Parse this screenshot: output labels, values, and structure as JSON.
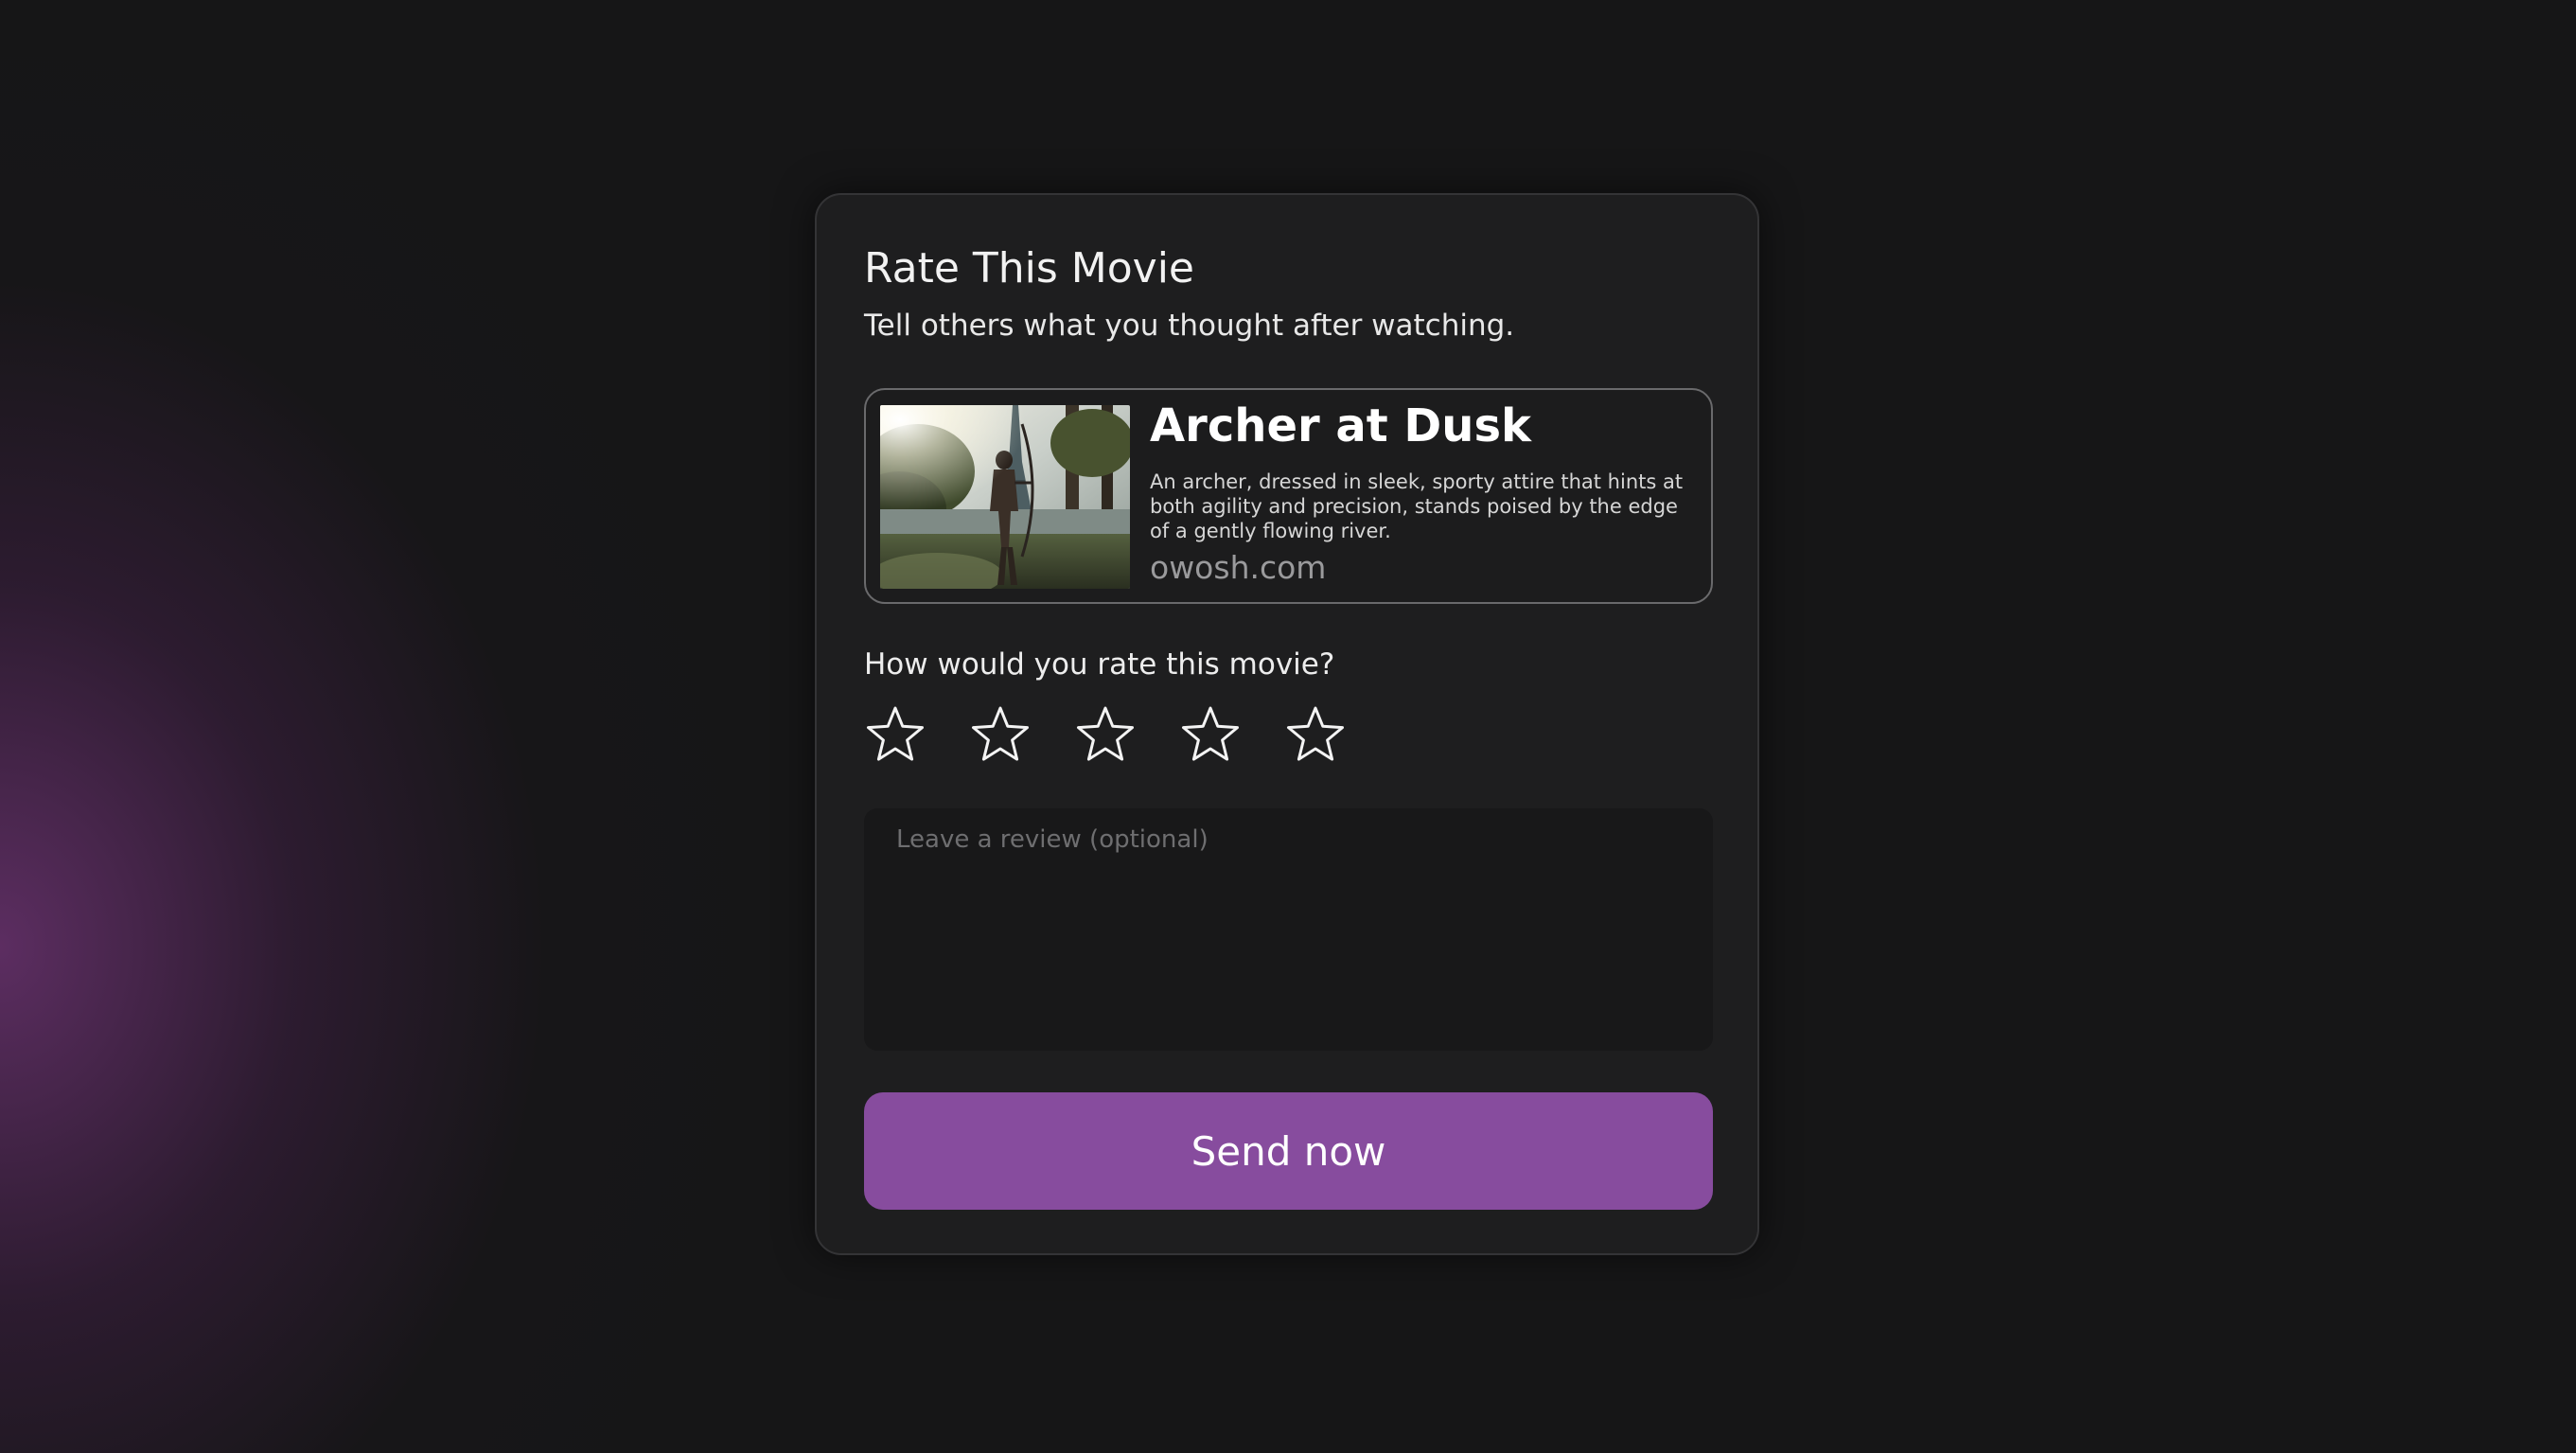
{
  "card": {
    "title": "Rate This Movie",
    "subtitle": "Tell others what you thought after watching."
  },
  "movie": {
    "title": "Archer at Dusk",
    "description": "An archer, dressed in sleek, sporty attire that hints at both agility and precision, stands poised by the edge of a gently flowing river.",
    "link": "owosh.com",
    "thumbnail_icon": "movie-thumbnail"
  },
  "rating": {
    "question": "How would you rate this movie?",
    "max_stars": 5,
    "selected": 0,
    "star_icon": "star-outline-icon"
  },
  "review": {
    "placeholder": "Leave a review (optional)",
    "value": ""
  },
  "submit": {
    "label": "Send now"
  },
  "colors": {
    "accent": "#874c9e",
    "card_background": "#1e1e1f",
    "page_background": "#161617"
  }
}
